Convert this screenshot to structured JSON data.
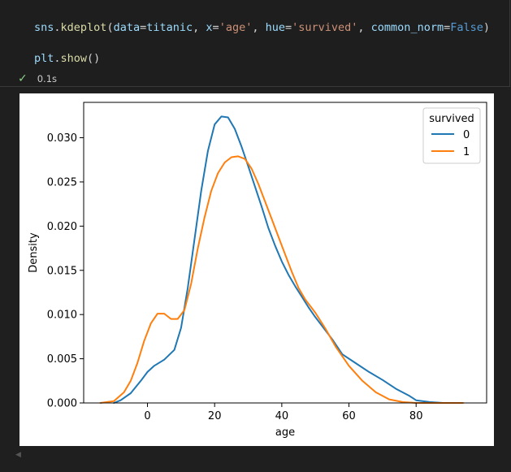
{
  "cell": {
    "code_lines": [
      [
        {
          "t": "sns",
          "c": "var"
        },
        {
          "t": ".",
          "c": "punct"
        },
        {
          "t": "kdeplot",
          "c": "fn"
        },
        {
          "t": "(",
          "c": "punct"
        },
        {
          "t": "data",
          "c": "var"
        },
        {
          "t": "=",
          "c": "punct"
        },
        {
          "t": "titanic",
          "c": "var"
        },
        {
          "t": ", ",
          "c": "punct"
        },
        {
          "t": "x",
          "c": "var"
        },
        {
          "t": "=",
          "c": "punct"
        },
        {
          "t": "'age'",
          "c": "str"
        },
        {
          "t": ", ",
          "c": "punct"
        },
        {
          "t": "hue",
          "c": "var"
        },
        {
          "t": "=",
          "c": "punct"
        },
        {
          "t": "'survived'",
          "c": "str"
        },
        {
          "t": ", ",
          "c": "punct"
        },
        {
          "t": "common_norm",
          "c": "var"
        },
        {
          "t": "=",
          "c": "punct"
        },
        {
          "t": "False",
          "c": "kw"
        },
        {
          "t": ")",
          "c": "punct"
        }
      ],
      [
        {
          "t": "plt",
          "c": "var"
        },
        {
          "t": ".",
          "c": "punct"
        },
        {
          "t": "show",
          "c": "fn"
        },
        {
          "t": "()",
          "c": "punct"
        }
      ]
    ],
    "status_icon": "check-icon",
    "exec_time": "0.1s"
  },
  "colors": {
    "series_0": "#1f77b4",
    "series_1": "#ff7f0e",
    "status_ok": "#89d185"
  },
  "chart_data": {
    "type": "line",
    "title": "",
    "xlabel": "age",
    "ylabel": "Density",
    "xlim": [
      -19,
      101
    ],
    "ylim": [
      0,
      0.034
    ],
    "xticks": [
      0,
      20,
      40,
      60,
      80
    ],
    "yticks": [
      "0.000",
      "0.005",
      "0.010",
      "0.015",
      "0.020",
      "0.025",
      "0.030"
    ],
    "ytick_values": [
      0,
      0.005,
      0.01,
      0.015,
      0.02,
      0.025,
      0.03
    ],
    "grid": false,
    "legend": {
      "title": "survived",
      "position": "top-right"
    },
    "series": [
      {
        "name": "0",
        "color": "#1f77b4",
        "x": [
          -10,
          -8,
          -5,
          -2,
          0,
          2,
          5,
          8,
          10,
          12,
          14,
          16,
          18,
          20,
          22,
          24,
          26,
          28,
          30,
          32,
          34,
          36,
          38,
          40,
          42,
          44,
          46,
          48,
          50,
          52,
          55,
          58,
          62,
          66,
          70,
          74,
          78,
          80,
          84,
          88
        ],
        "y": [
          0.0,
          0.0003,
          0.0011,
          0.0025,
          0.0035,
          0.0042,
          0.0049,
          0.006,
          0.0085,
          0.013,
          0.0185,
          0.024,
          0.0285,
          0.0315,
          0.0324,
          0.0323,
          0.031,
          0.029,
          0.0268,
          0.0245,
          0.0222,
          0.0198,
          0.0178,
          0.016,
          0.0145,
          0.0132,
          0.012,
          0.0108,
          0.0097,
          0.0087,
          0.0072,
          0.0055,
          0.0045,
          0.0035,
          0.0026,
          0.0016,
          0.0008,
          0.0003,
          0.0001,
          0.0
        ]
      },
      {
        "name": "1",
        "color": "#ff7f0e",
        "x": [
          -14,
          -10,
          -7,
          -5,
          -3,
          -1,
          1,
          3,
          5,
          7,
          9,
          11,
          13,
          15,
          17,
          19,
          21,
          23,
          25,
          27,
          29,
          31,
          33,
          35,
          37,
          39,
          41,
          43,
          45,
          47,
          50,
          53,
          56,
          60,
          64,
          68,
          72,
          76,
          80,
          85,
          90,
          94
        ],
        "y": [
          0.0,
          0.0002,
          0.0012,
          0.0025,
          0.0045,
          0.007,
          0.009,
          0.0101,
          0.0101,
          0.0095,
          0.0095,
          0.0105,
          0.0135,
          0.0175,
          0.021,
          0.024,
          0.026,
          0.0272,
          0.0278,
          0.0279,
          0.0276,
          0.0265,
          0.0248,
          0.0228,
          0.0208,
          0.0188,
          0.0168,
          0.0148,
          0.013,
          0.0117,
          0.0102,
          0.0084,
          0.0064,
          0.0042,
          0.0025,
          0.0012,
          0.0004,
          0.0001,
          0.0,
          0.0,
          0.0,
          0.0
        ]
      }
    ]
  }
}
